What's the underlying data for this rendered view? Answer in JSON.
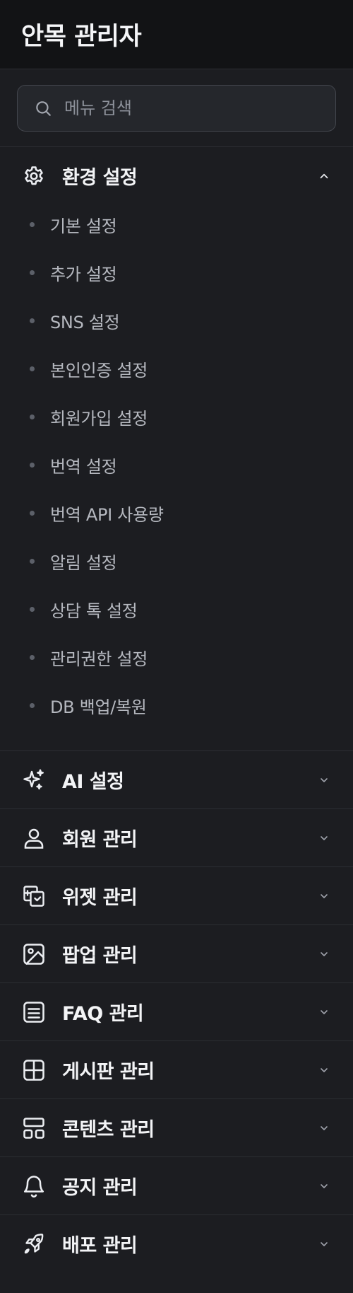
{
  "app": {
    "title": "안목 관리자"
  },
  "search": {
    "placeholder": "메뉴 검색"
  },
  "colors": {
    "background": "#1c1d21",
    "header_background": "#121315",
    "divider": "#2c2e33",
    "text_primary": "#f3f4f6",
    "text_secondary": "#b5b8bf"
  },
  "sections": [
    {
      "label": "환경 설정",
      "icon": "gear-icon",
      "expanded": true,
      "items": [
        {
          "label": "기본 설정"
        },
        {
          "label": "추가 설정"
        },
        {
          "label": "SNS 설정"
        },
        {
          "label": "본인인증 설정"
        },
        {
          "label": "회원가입 설정"
        },
        {
          "label": "번역 설정"
        },
        {
          "label": "번역 API 사용량"
        },
        {
          "label": "알림 설정"
        },
        {
          "label": "상담 톡 설정"
        },
        {
          "label": "관리권한 설정"
        },
        {
          "label": "DB 백업/복원"
        }
      ]
    },
    {
      "label": "AI 설정",
      "icon": "sparkles-icon",
      "expanded": false
    },
    {
      "label": "회원 관리",
      "icon": "user-icon",
      "expanded": false
    },
    {
      "label": "위젯 관리",
      "icon": "widget-icon",
      "expanded": false
    },
    {
      "label": "팝업 관리",
      "icon": "image-icon",
      "expanded": false
    },
    {
      "label": "FAQ 관리",
      "icon": "list-icon",
      "expanded": false
    },
    {
      "label": "게시판 관리",
      "icon": "grid-icon",
      "expanded": false
    },
    {
      "label": "콘텐츠 관리",
      "icon": "layout-icon",
      "expanded": false
    },
    {
      "label": "공지 관리",
      "icon": "bell-icon",
      "expanded": false
    },
    {
      "label": "배포 관리",
      "icon": "rocket-icon",
      "expanded": false
    }
  ]
}
